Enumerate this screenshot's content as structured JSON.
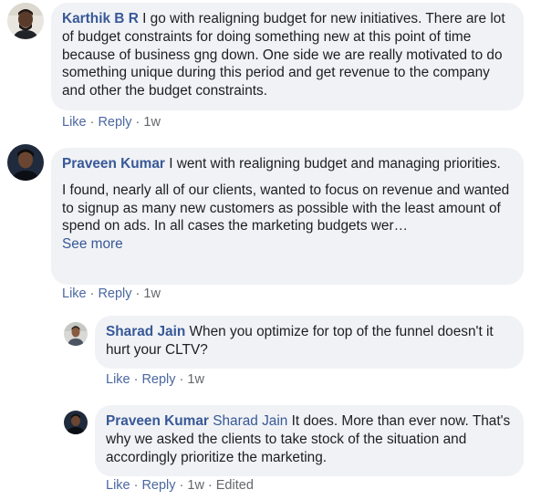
{
  "comments": [
    {
      "author": "Karthik B R",
      "paragraphs": [
        "I go with realigning budget for new initiatives. There are lot of budget constraints for doing something new at this point of time because of business gng down. One side we are really motivated to do something unique during this period and get revenue to the company and other the budget constraints."
      ],
      "actions": {
        "like": "Like",
        "reply": "Reply",
        "time": "1w"
      }
    },
    {
      "author": "Praveen Kumar",
      "paragraphs": [
        "I went with realigning budget and managing priorities.",
        "I found, nearly all of our clients, wanted to focus on revenue and wanted to signup as many new customers as possible with the least amount of spend on ads. In all cases the marketing budgets wer…"
      ],
      "see_more": "See more",
      "actions": {
        "like": "Like",
        "reply": "Reply",
        "time": "1w"
      }
    },
    {
      "author": "Sharad Jain",
      "paragraphs": [
        "When you optimize for top of the funnel doesn't it hurt your CLTV?"
      ],
      "actions": {
        "like": "Like",
        "reply": "Reply",
        "time": "1w"
      }
    },
    {
      "author": "Praveen Kumar",
      "mention": "Sharad Jain",
      "paragraphs": [
        "It does. More than ever now. That's why we asked the clients to take stock of the situation and accordingly prioritize the marketing."
      ],
      "actions": {
        "like": "Like",
        "reply": "Reply",
        "time": "1w",
        "edited": "Edited"
      }
    }
  ],
  "colors": {
    "bubble": "#f0f2f5",
    "author": "#385898",
    "action_link": "#4b67a1",
    "meta": "#65676b"
  }
}
